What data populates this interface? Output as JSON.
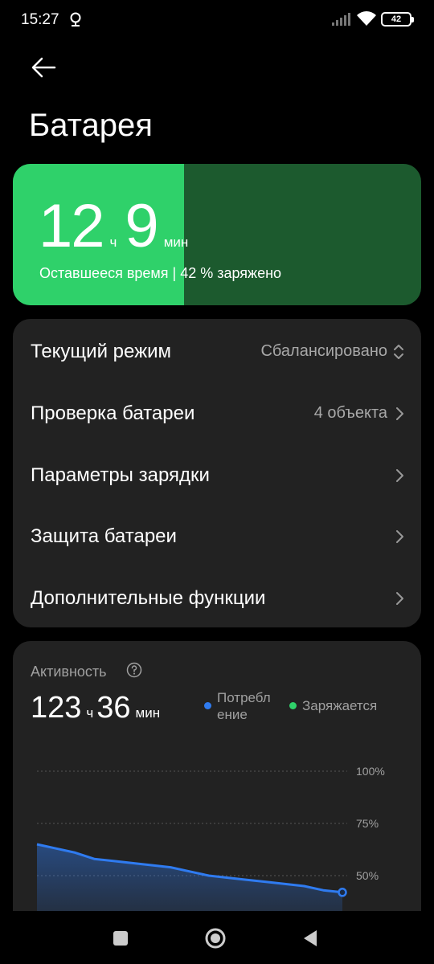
{
  "status_bar": {
    "time": "15:27",
    "battery_level": "42",
    "icons": [
      "alarm-icon",
      "signal-icon",
      "wifi-icon",
      "battery-icon"
    ]
  },
  "header": {
    "back_icon": "back-arrow-icon",
    "title": "Батарея"
  },
  "battery_card": {
    "hours": "12",
    "hours_unit": "ч",
    "minutes": "9",
    "minutes_unit": "мин",
    "caption": "Оставшееся время | 42 % заряжено",
    "charge_fraction": 0.42,
    "fill_color": "#2fd16a",
    "track_color": "#1c5a2e"
  },
  "settings": [
    {
      "label": "Текущий режим",
      "value": "Сбалансировано",
      "icon": "up-down-arrows-icon"
    },
    {
      "label": "Проверка батареи",
      "value": "4 объекта",
      "icon": "chevron-right-icon"
    },
    {
      "label": "Параметры зарядки",
      "value": "",
      "icon": "chevron-right-icon"
    },
    {
      "label": "Защита батареи",
      "value": "",
      "icon": "chevron-right-icon"
    },
    {
      "label": "Дополнительные функции",
      "value": "",
      "icon": "chevron-right-icon"
    }
  ],
  "activity": {
    "title": "Активность",
    "help_icon": "help-circle-icon",
    "hours": "123",
    "hours_unit": "ч",
    "minutes": "36",
    "minutes_unit": "мин",
    "legend": [
      {
        "label_line1": "Потребл",
        "label_line2": "ение",
        "color": "#2f7bf0"
      },
      {
        "label": "Заряжается",
        "color": "#2fd16a"
      }
    ]
  },
  "chart_data": {
    "type": "area",
    "y_tick_labels": [
      "100%",
      "75%",
      "50%"
    ],
    "ylim": [
      0,
      100
    ],
    "series": [
      {
        "color": "#2f7bf0",
        "values": [
          65,
          63,
          61,
          58,
          57,
          56,
          55,
          54,
          52,
          50,
          49,
          48,
          47,
          46,
          45,
          43,
          42
        ]
      }
    ],
    "grid": true
  },
  "nav_bar": {
    "buttons": [
      "recents-square-icon",
      "home-circle-icon",
      "back-triangle-icon"
    ]
  }
}
